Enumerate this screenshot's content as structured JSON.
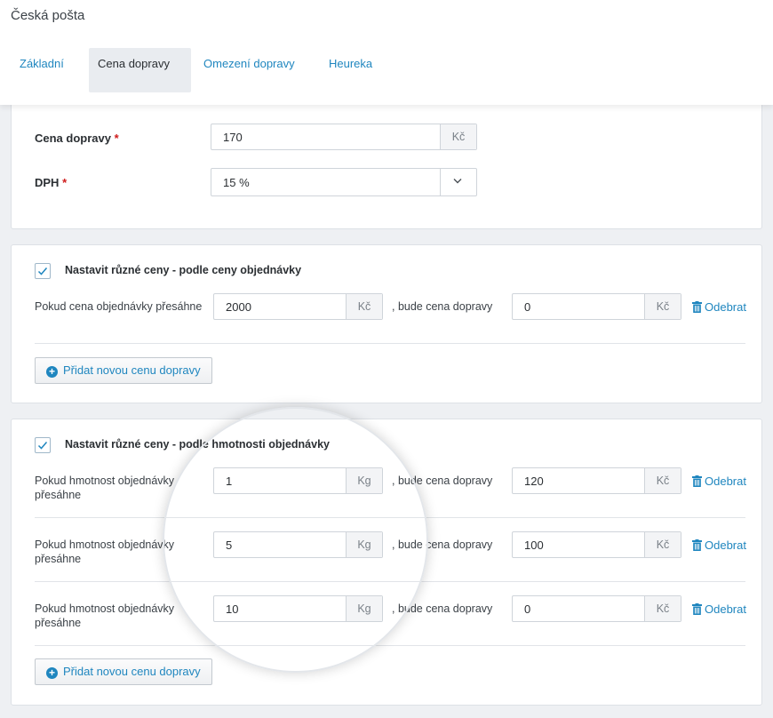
{
  "app": {
    "title": "Česká pošta"
  },
  "tabs": [
    {
      "label": "Základní",
      "active": false
    },
    {
      "label": "Cena dopravy",
      "active": true
    },
    {
      "label": "Omezení dopravy",
      "active": false
    },
    {
      "label": "Heureka",
      "active": false
    }
  ],
  "pricing": {
    "price_label": "Cena dopravy",
    "price_value": "170",
    "price_unit": "Kč",
    "vat_label": "DPH",
    "vat_value": "15 %",
    "required_mark": "*"
  },
  "by_order_price": {
    "checkbox_label": "Nastavit různé ceny - podle ceny objednávky",
    "checked": true,
    "rows": [
      {
        "condition": "Pokud cena objednávky přesáhne",
        "threshold": "2000",
        "threshold_unit": "Kč",
        "then_text": ", bude cena dopravy",
        "price": "0",
        "price_unit": "Kč",
        "remove_label": "Odebrat"
      }
    ],
    "add_label": "Přidat novou cenu dopravy"
  },
  "by_weight": {
    "checkbox_label": "Nastavit různé ceny - podle hmotnosti objednávky",
    "checked": true,
    "rows": [
      {
        "condition": "Pokud hmotnost objednávky přesáhne",
        "threshold": "1",
        "threshold_unit": "Kg",
        "then_text": ", bude cena dopravy",
        "price": "120",
        "price_unit": "Kč",
        "remove_label": "Odebrat"
      },
      {
        "condition": "Pokud hmotnost objednávky přesáhne",
        "threshold": "5",
        "threshold_unit": "Kg",
        "then_text": ", bude cena dopravy",
        "price": "100",
        "price_unit": "Kč",
        "remove_label": "Odebrat"
      },
      {
        "condition": "Pokud hmotnost objednávky přesáhne",
        "threshold": "10",
        "threshold_unit": "Kg",
        "then_text": ", bude cena dopravy",
        "price": "0",
        "price_unit": "Kč",
        "remove_label": "Odebrat"
      }
    ],
    "add_label": "Přidat novou cenu dopravy"
  },
  "colors": {
    "accent": "#1f86bf",
    "required": "#cf1b1b",
    "active_tab_bg": "#e9ecf0"
  },
  "icons": {
    "checkbox": "check-icon",
    "remove": "trash-icon",
    "add": "plus-circle-icon",
    "select": "chevron-down-icon"
  }
}
